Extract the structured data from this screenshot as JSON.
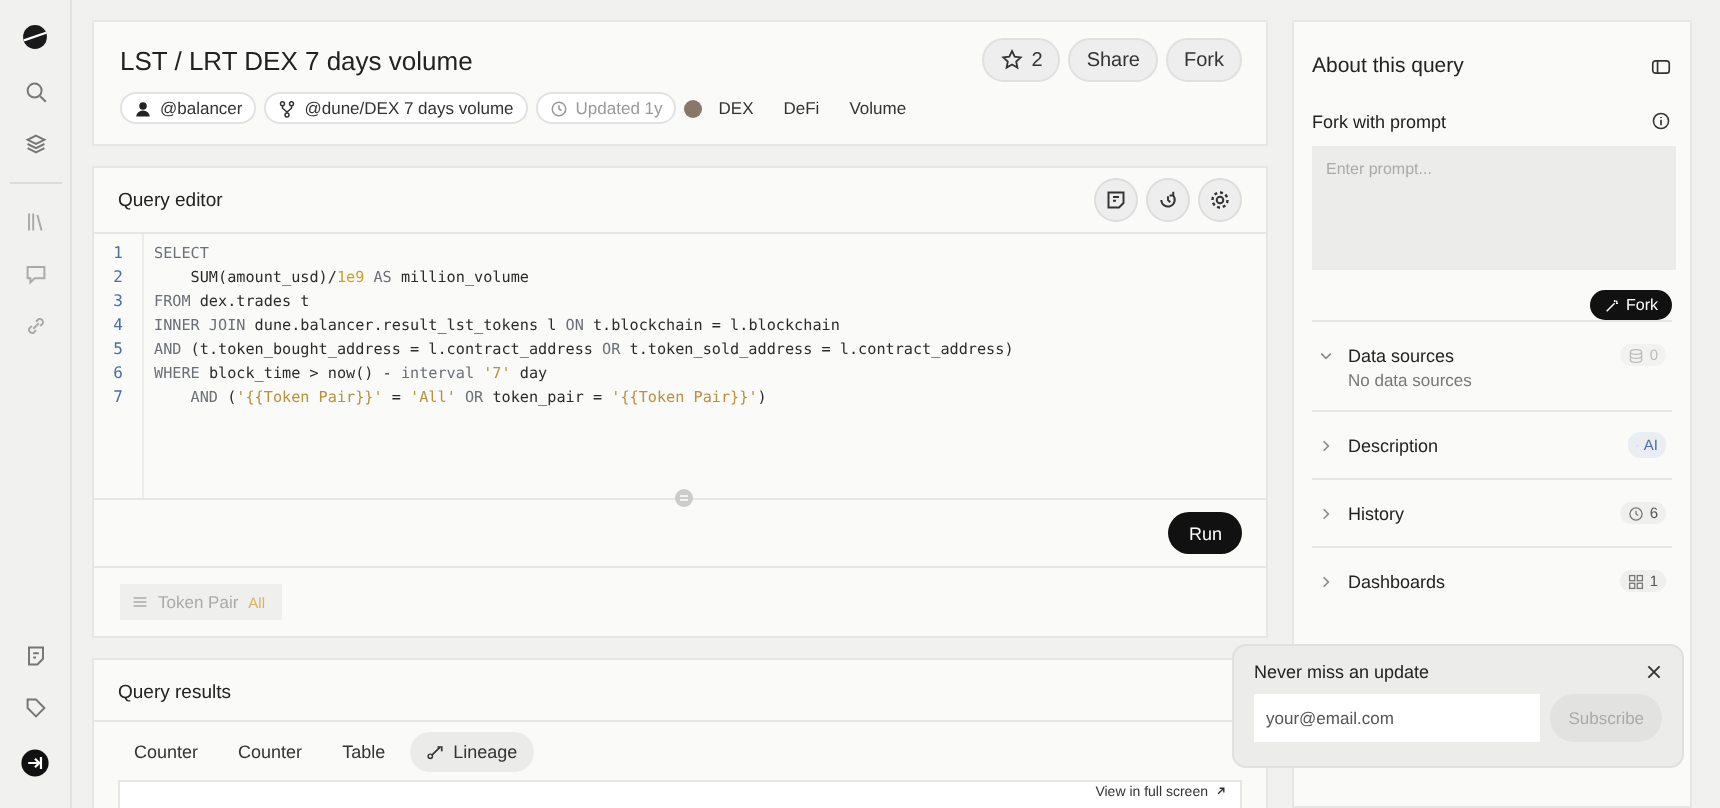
{
  "header": {
    "title": "LST / LRT DEX 7 days volume",
    "stars": "2",
    "actions": [
      "Share",
      "Fork"
    ],
    "chips": [
      {
        "kind": "user",
        "label": "@balancer"
      },
      {
        "kind": "fork",
        "label": "@dune/DEX 7 days volume"
      },
      {
        "kind": "updated",
        "label": "Updated 1y"
      }
    ],
    "tags": [
      "DEX",
      "DeFi",
      "Volume"
    ]
  },
  "editor": {
    "title": "Query editor",
    "run_label": "Run",
    "lines": [
      {
        "number": "1",
        "tokens": [
          {
            "kind": "keyword",
            "text": "SELECT"
          }
        ]
      },
      {
        "number": "2",
        "tokens": [
          {
            "kind": "plain",
            "text": "    SUM(amount_usd)/"
          },
          {
            "kind": "number",
            "text": "1e9"
          },
          {
            "kind": "keyword",
            "text": " AS "
          },
          {
            "kind": "plain",
            "text": "million_volume"
          }
        ]
      },
      {
        "number": "3",
        "tokens": [
          {
            "kind": "keyword",
            "text": "FROM "
          },
          {
            "kind": "plain",
            "text": "dex.trades t"
          }
        ]
      },
      {
        "number": "4",
        "tokens": [
          {
            "kind": "keyword",
            "text": "INNER JOIN "
          },
          {
            "kind": "plain",
            "text": "dune.balancer.result_lst_tokens l "
          },
          {
            "kind": "keyword",
            "text": "ON "
          },
          {
            "kind": "plain",
            "text": "t.blockchain = l.blockchain"
          }
        ]
      },
      {
        "number": "5",
        "tokens": [
          {
            "kind": "keyword",
            "text": "AND "
          },
          {
            "kind": "plain",
            "text": "(t.token_bought_address = l.contract_address "
          },
          {
            "kind": "keyword",
            "text": "OR "
          },
          {
            "kind": "plain",
            "text": "t.token_sold_address = l.contract_address)"
          }
        ]
      },
      {
        "number": "6",
        "tokens": [
          {
            "kind": "keyword",
            "text": "WHERE "
          },
          {
            "kind": "plain",
            "text": "block_time > now() - "
          },
          {
            "kind": "keyword",
            "text": "interval "
          },
          {
            "kind": "string",
            "text": "'7'"
          },
          {
            "kind": "plain",
            "text": " day"
          }
        ]
      },
      {
        "number": "7",
        "tokens": [
          {
            "kind": "keyword",
            "text": "    AND "
          },
          {
            "kind": "plain",
            "text": "("
          },
          {
            "kind": "string",
            "text": "'{{Token Pair}}'"
          },
          {
            "kind": "plain",
            "text": " = "
          },
          {
            "kind": "string",
            "text": "'All'"
          },
          {
            "kind": "keyword",
            "text": " OR "
          },
          {
            "kind": "plain",
            "text": "token_pair = "
          },
          {
            "kind": "string",
            "text": "'{{Token Pair}}'"
          },
          {
            "kind": "plain",
            "text": ")"
          }
        ]
      }
    ],
    "parameter": {
      "name": "Token Pair",
      "value": "All"
    }
  },
  "results": {
    "title": "Query results",
    "tabs": [
      {
        "label": "Counter",
        "kind": "plain",
        "selected": false
      },
      {
        "label": "Counter",
        "kind": "plain",
        "selected": false
      },
      {
        "label": "Table",
        "kind": "plain",
        "selected": false
      },
      {
        "label": "Lineage",
        "kind": "lineage",
        "selected": true
      }
    ],
    "fullscreen_link": "View in full screen"
  },
  "about": {
    "title": "About this query",
    "fork_label": "Fork with prompt",
    "prompt_placeholder": "Enter prompt...",
    "fork_button": "Fork",
    "sections": [
      {
        "kind": "sources",
        "title": "Data sources",
        "expanded": true,
        "badge": "0",
        "empty_text": "No data sources"
      },
      {
        "kind": "ai",
        "title": "Description",
        "expanded": false,
        "badge": "AI"
      },
      {
        "kind": "history",
        "title": "History",
        "expanded": false,
        "badge": "6"
      },
      {
        "kind": "dashboards",
        "title": "Dashboards",
        "expanded": false,
        "badge": "1"
      }
    ]
  },
  "toast": {
    "title": "Never miss an update",
    "placeholder": "your@email.com",
    "button": "Subscribe"
  }
}
